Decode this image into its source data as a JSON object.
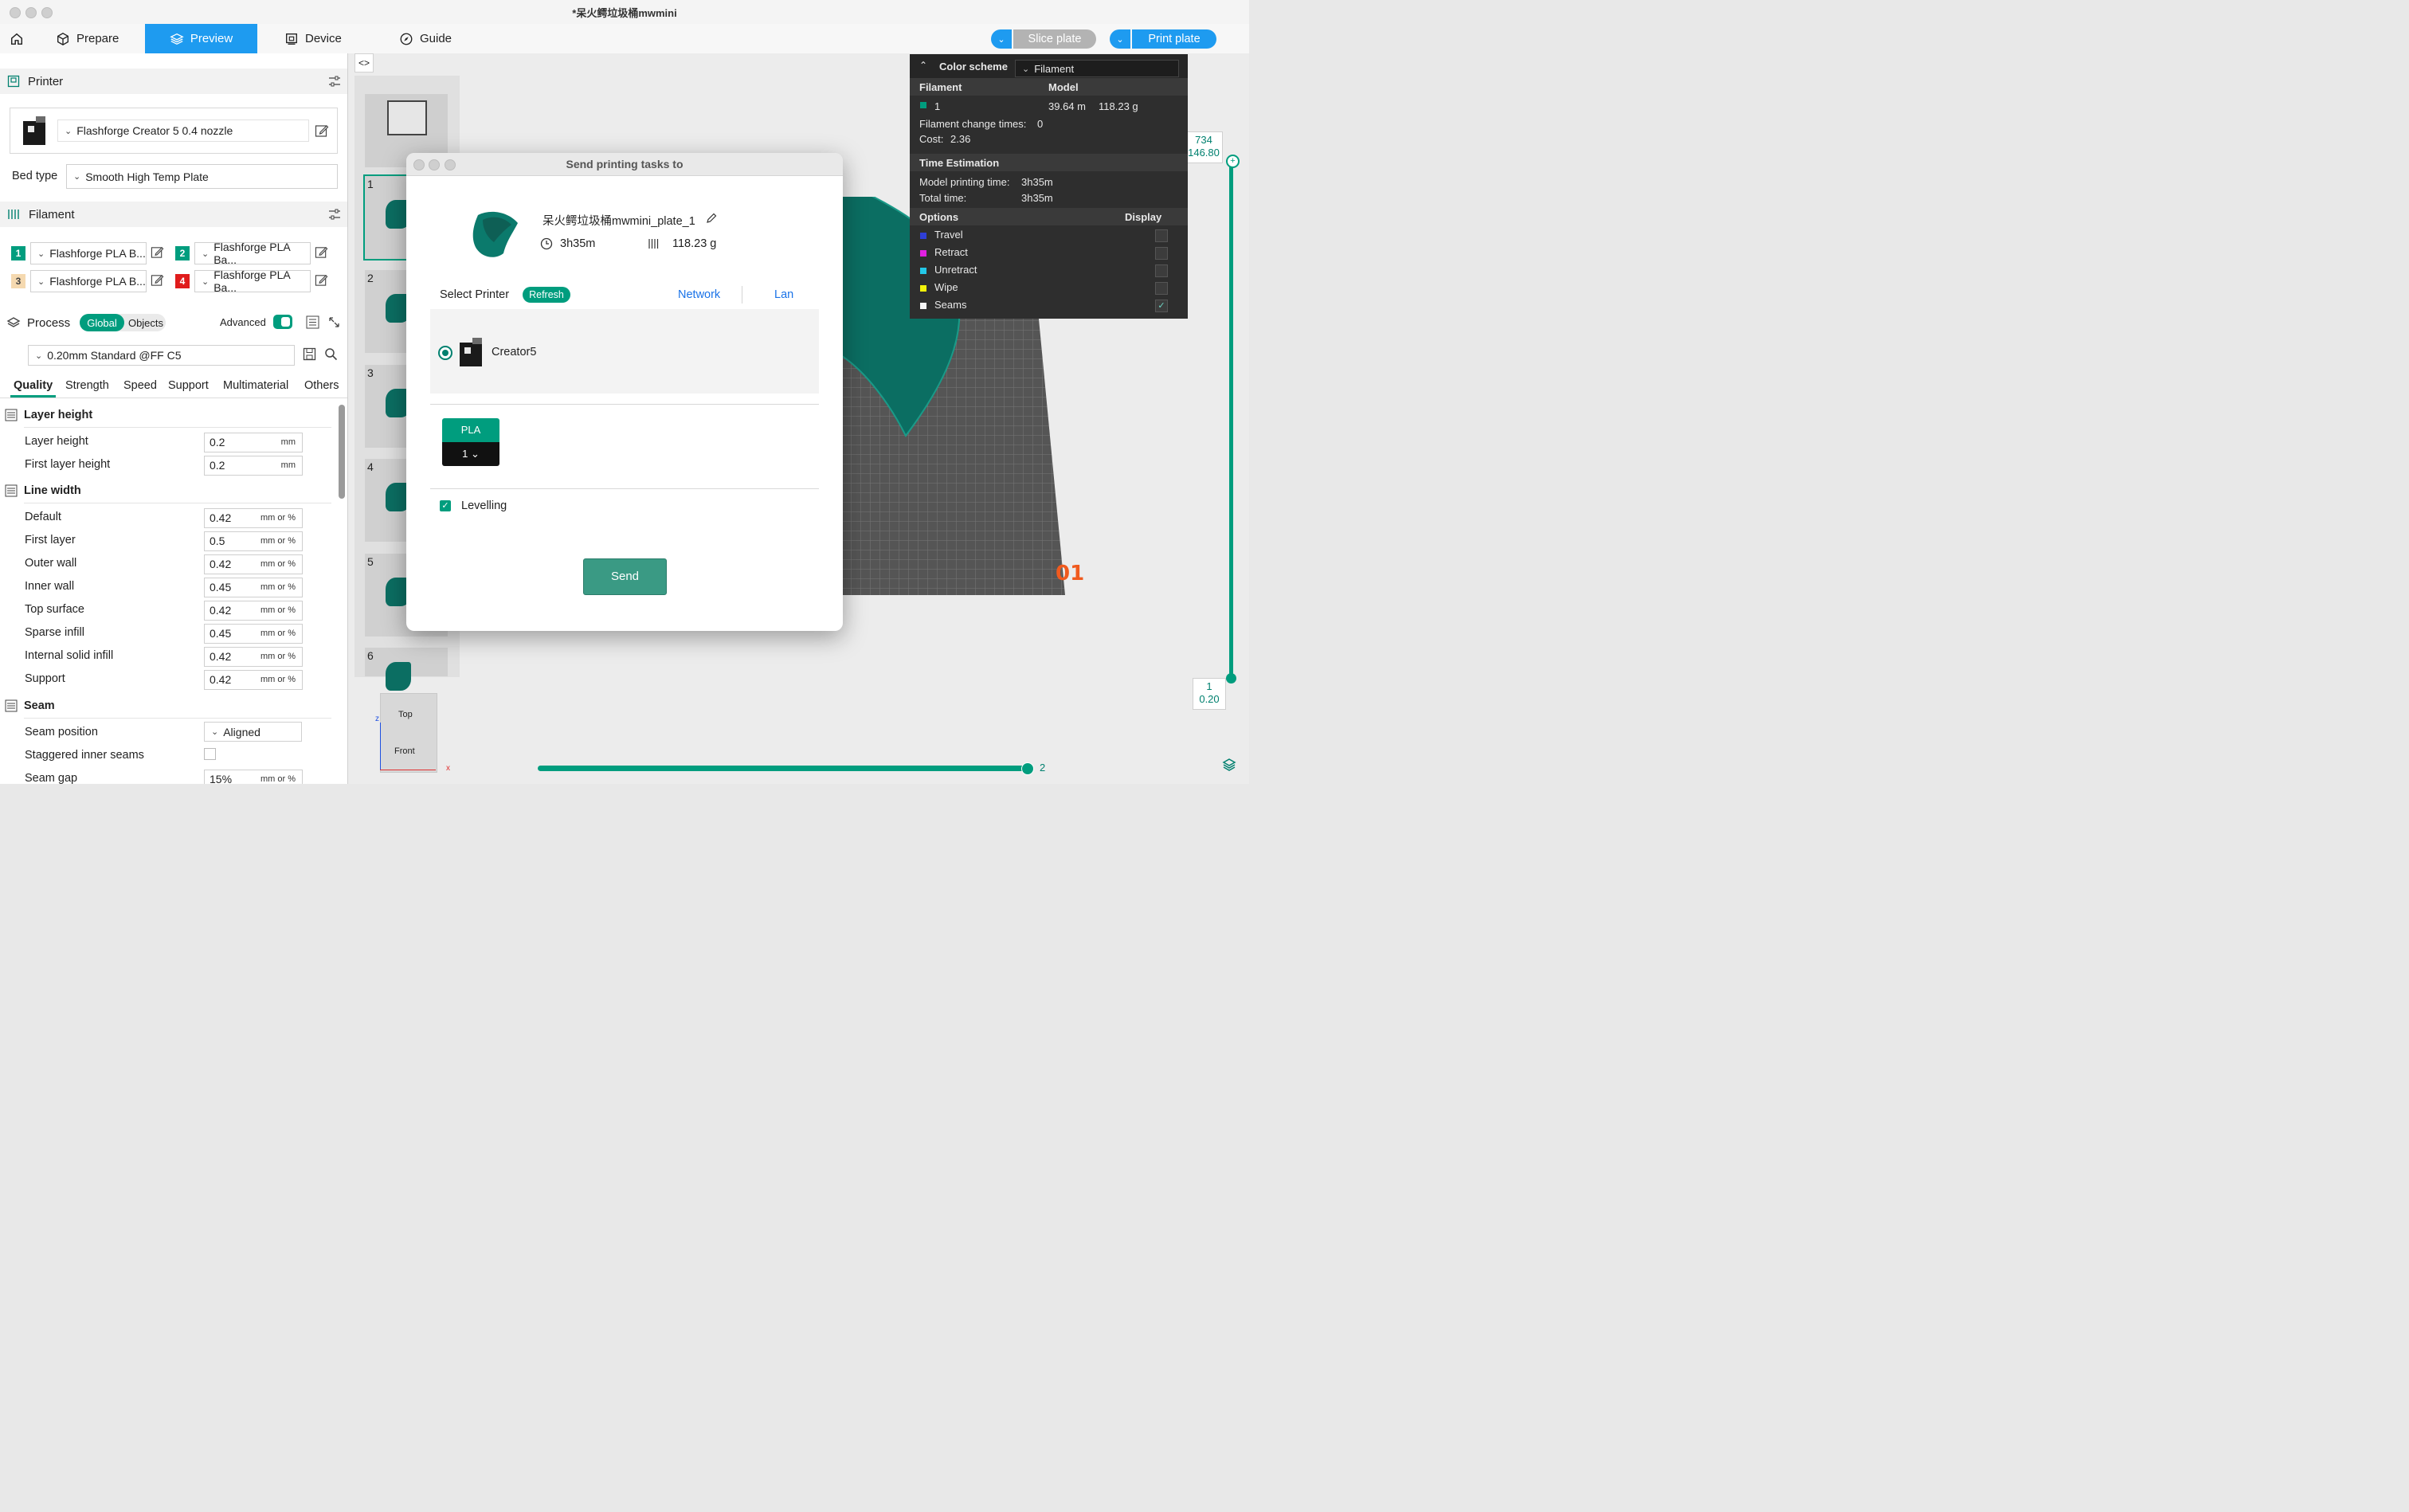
{
  "window": {
    "title": "*呆火鳄垃圾桶mwmini"
  },
  "toolbar": {
    "tabs": [
      {
        "label": "Prepare"
      },
      {
        "label": "Preview"
      },
      {
        "label": "Device"
      },
      {
        "label": "Guide"
      }
    ],
    "slice_label": "Slice plate",
    "print_label": "Print plate"
  },
  "printer_section": {
    "title": "Printer",
    "printer_name": "Flashforge Creator 5 0.4 nozzle",
    "bed_type_label": "Bed type",
    "bed_type_value": "Smooth High Temp Plate"
  },
  "filament_section": {
    "title": "Filament",
    "slots": [
      {
        "num": "1",
        "name": "Flashforge PLA B...",
        "color": "#009d7e"
      },
      {
        "num": "2",
        "name": "Flashforge PLA Ba...",
        "color": "#009d7e"
      },
      {
        "num": "3",
        "name": "Flashforge PLA B...",
        "color": "#f5d9b0"
      },
      {
        "num": "4",
        "name": "Flashforge PLA Ba...",
        "color": "#e01c1c"
      }
    ]
  },
  "process_section": {
    "title": "Process",
    "global_label": "Global",
    "objects_label": "Objects",
    "advanced_label": "Advanced",
    "preset": "0.20mm Standard @FF C5",
    "tabs": [
      "Quality",
      "Strength",
      "Speed",
      "Support",
      "Multimaterial",
      "Others"
    ]
  },
  "quality": {
    "layer_height_group": "Layer height",
    "line_width_group": "Line width",
    "seam_group": "Seam",
    "layer_rows": [
      {
        "label": "Layer height",
        "value": "0.2",
        "unit": "mm"
      },
      {
        "label": "First layer height",
        "value": "0.2",
        "unit": "mm"
      }
    ],
    "line_rows": [
      {
        "label": "Default",
        "value": "0.42",
        "unit": "mm or %"
      },
      {
        "label": "First layer",
        "value": "0.5",
        "unit": "mm or %"
      },
      {
        "label": "Outer wall",
        "value": "0.42",
        "unit": "mm or %"
      },
      {
        "label": "Inner wall",
        "value": "0.45",
        "unit": "mm or %"
      },
      {
        "label": "Top surface",
        "value": "0.42",
        "unit": "mm or %"
      },
      {
        "label": "Sparse infill",
        "value": "0.45",
        "unit": "mm or %"
      },
      {
        "label": "Internal solid infill",
        "value": "0.42",
        "unit": "mm or %"
      },
      {
        "label": "Support",
        "value": "0.42",
        "unit": "mm or %"
      }
    ],
    "seam_position_label": "Seam position",
    "seam_position_value": "Aligned",
    "staggered_label": "Staggered inner seams",
    "seam_gap_label": "Seam gap",
    "seam_gap_value": "15%",
    "seam_gap_unit": "mm or %"
  },
  "plates": {
    "numbers": [
      "1",
      "2",
      "3",
      "4",
      "5",
      "6"
    ]
  },
  "color_scheme": {
    "title": "Color scheme",
    "selected": "Filament",
    "col_filament": "Filament",
    "col_model": "Model",
    "row_num": "1",
    "length": "39.64 m",
    "weight": "118.23 g",
    "change_times_label": "Filament change times:",
    "change_times_value": "0",
    "cost_label": "Cost:",
    "cost_value": "2.36",
    "time_title": "Time Estimation",
    "model_time_label": "Model printing time:",
    "model_time_value": "3h35m",
    "total_time_label": "Total time:",
    "total_time_value": "3h35m",
    "options_label": "Options",
    "display_label": "Display",
    "options": [
      {
        "label": "Travel",
        "color": "#2f3fd6"
      },
      {
        "label": "Retract",
        "color": "#e020e0"
      },
      {
        "label": "Unretract",
        "color": "#23c8e8"
      },
      {
        "label": "Wipe",
        "color": "#f2f20a"
      },
      {
        "label": "Seams",
        "color": "#f5f5f5"
      }
    ]
  },
  "layer_slider": {
    "top_layer": "734",
    "top_height": "146.80",
    "bottom_layer": "1",
    "bottom_height": "0.20",
    "move_value": "2"
  },
  "view_cube": {
    "top": "Top",
    "front": "Front",
    "z": "z",
    "x": "x"
  },
  "plate_label": "01",
  "dialog": {
    "title": "Send printing tasks to",
    "plate_name": "呆火鳄垃圾桶mwmini_plate_1",
    "time": "3h35m",
    "weight": "118.23 g",
    "select_printer_label": "Select Printer",
    "refresh_label": "Refresh",
    "network_label": "Network",
    "lan_label": "Lan",
    "printer_name": "Creator5",
    "material_type": "PLA",
    "material_slot": "1",
    "levelling_label": "Levelling",
    "send_label": "Send"
  }
}
